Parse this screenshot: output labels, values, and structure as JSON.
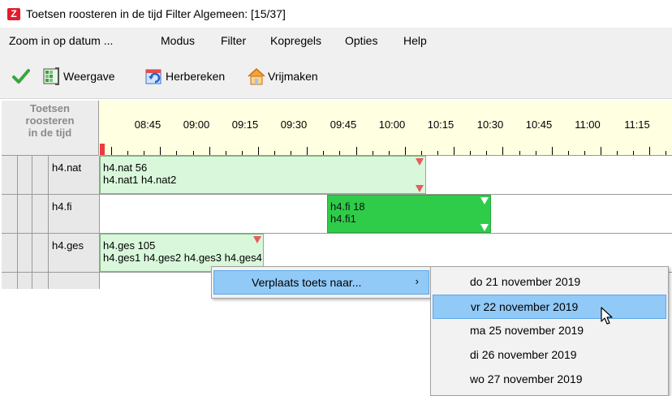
{
  "window": {
    "title": "Toetsen roosteren in de tijd  Filter Algemeen: [15/37]",
    "icon": "app-logo-icon"
  },
  "menu": [
    "Zoom in op datum ...",
    "Modus",
    "Filter",
    "Kopregels",
    "Opties",
    "Help"
  ],
  "toolbar": {
    "confirm_icon": "check-icon",
    "weergave": "Weergave",
    "herbereken": "Herbereken",
    "vrijmaken": "Vrijmaken"
  },
  "grid": {
    "corner_title": "Toetsen roosteren in de tijd",
    "time_labels": [
      "08:45",
      "09:00",
      "09:15",
      "09:30",
      "09:45",
      "10:00",
      "10:15",
      "10:30",
      "10:45",
      "11:00",
      "11:15"
    ],
    "rows": [
      {
        "name": "h4.nat",
        "block_title": "h4.nat 56",
        "block_groups": "h4.nat1 h4.nat2"
      },
      {
        "name": "h4.fi",
        "block_title": "h4.fi 18",
        "block_groups": "h4.fi1"
      },
      {
        "name": "h4.ges",
        "block_title": "h4.ges 105",
        "block_groups": "h4.ges1 h4.ges2 h4.ges3 h4.ges4"
      },
      {
        "name": ""
      }
    ]
  },
  "context_menu": {
    "item": "Verplaats toets naar...",
    "submenu": [
      "do 21 november 2019",
      "vr 22 november 2019",
      "ma 25 november 2019",
      "di 26 november 2019",
      "wo 27 november 2019"
    ],
    "highlighted": "vr 22 november 2019"
  },
  "colors": {
    "timeline_bg": "#ffffe1",
    "block_light": "#d9f7db",
    "block_dark": "#2fcc4a",
    "menu_highlight": "#91c9f7"
  }
}
